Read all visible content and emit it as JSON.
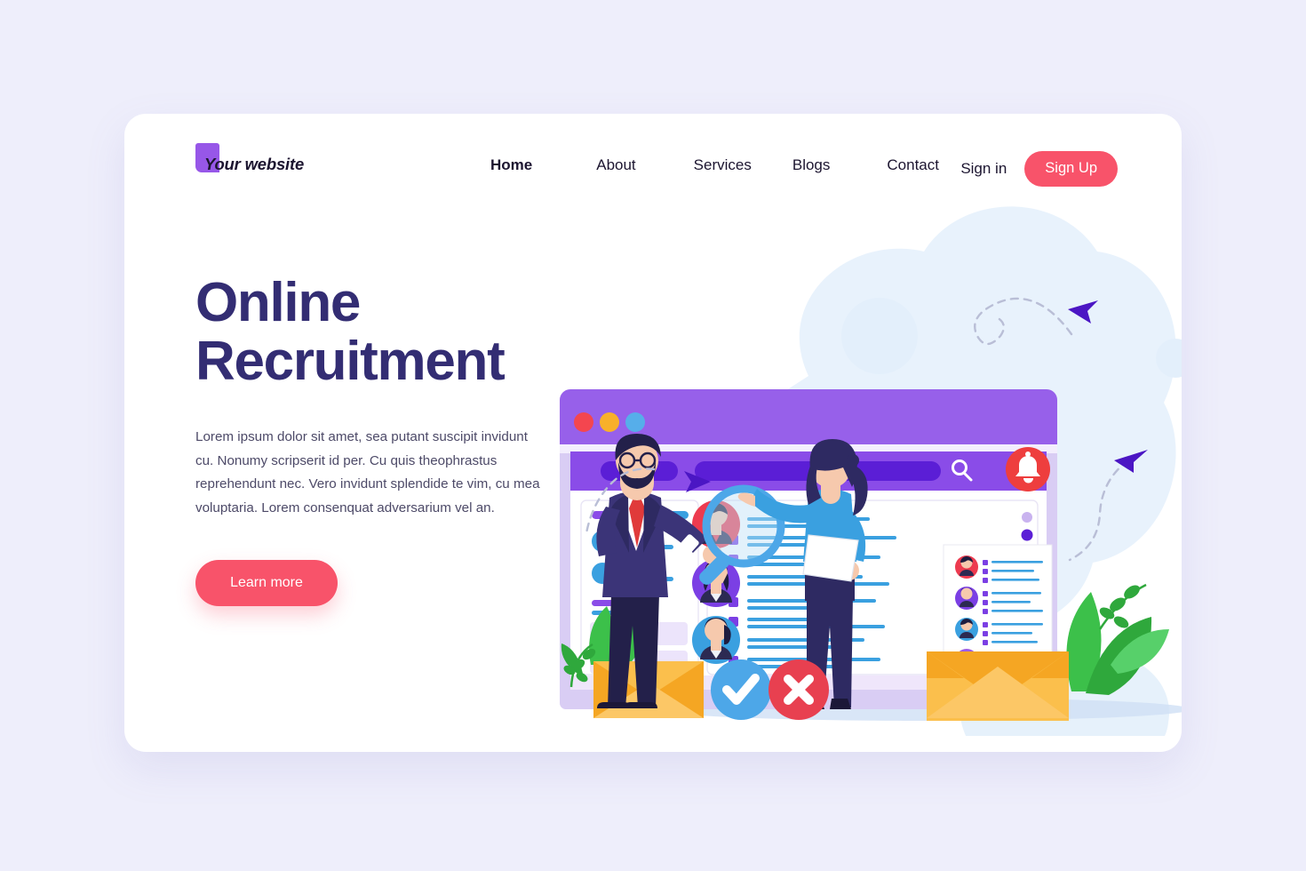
{
  "page": {
    "background_color": "#eeeefb",
    "card_background": "#ffffff"
  },
  "navbar": {
    "brand": {
      "label": "Your website",
      "swatch_color": "#9757e8"
    },
    "links": [
      {
        "label": "Home",
        "active": true
      },
      {
        "label": "About",
        "active": false
      },
      {
        "label": "Services",
        "active": false
      },
      {
        "label": "Blogs",
        "active": false
      },
      {
        "label": "Contact",
        "active": false
      }
    ],
    "signin_label": "Sign in",
    "signup_label": "Sign Up",
    "signup_color": "#f8536a"
  },
  "hero": {
    "title_line_1": "Online",
    "title_line_2": "Recruitment",
    "title_color": "#332d73",
    "paragraph": "Lorem ipsum dolor sit amet, sea putant suscipit invidunt cu. Nonumy scripserit id per. Cu quis theophrastus reprehendunt nec. Vero invidunt splendide te vim, cu mea voluptaria. Lorem consenquat adversarium vel an.",
    "cta_label": "Learn more",
    "cta_color": "#f8536a"
  },
  "illustration": {
    "name": "online-recruitment-illustration",
    "browser_window": {
      "titlebar_color": "#9760ea",
      "dots": [
        "#f4464f",
        "#f8b02a",
        "#56aeea"
      ],
      "search_bar_color": "#5b1ed6",
      "search_icon": "magnifier-icon"
    },
    "badges": {
      "notification_bell": {
        "icon": "bell-icon",
        "color": "#ee3e3e"
      },
      "approve": {
        "icon": "check-icon",
        "color": "#4da7e8"
      },
      "reject": {
        "icon": "cross-icon",
        "color": "#e84050"
      }
    },
    "accent_colors": {
      "purple": "#7b3fe4",
      "blue": "#3aa0e0",
      "orange": "#f5a623",
      "green": "#3cc04a",
      "arrow": "#4b16c4"
    }
  }
}
